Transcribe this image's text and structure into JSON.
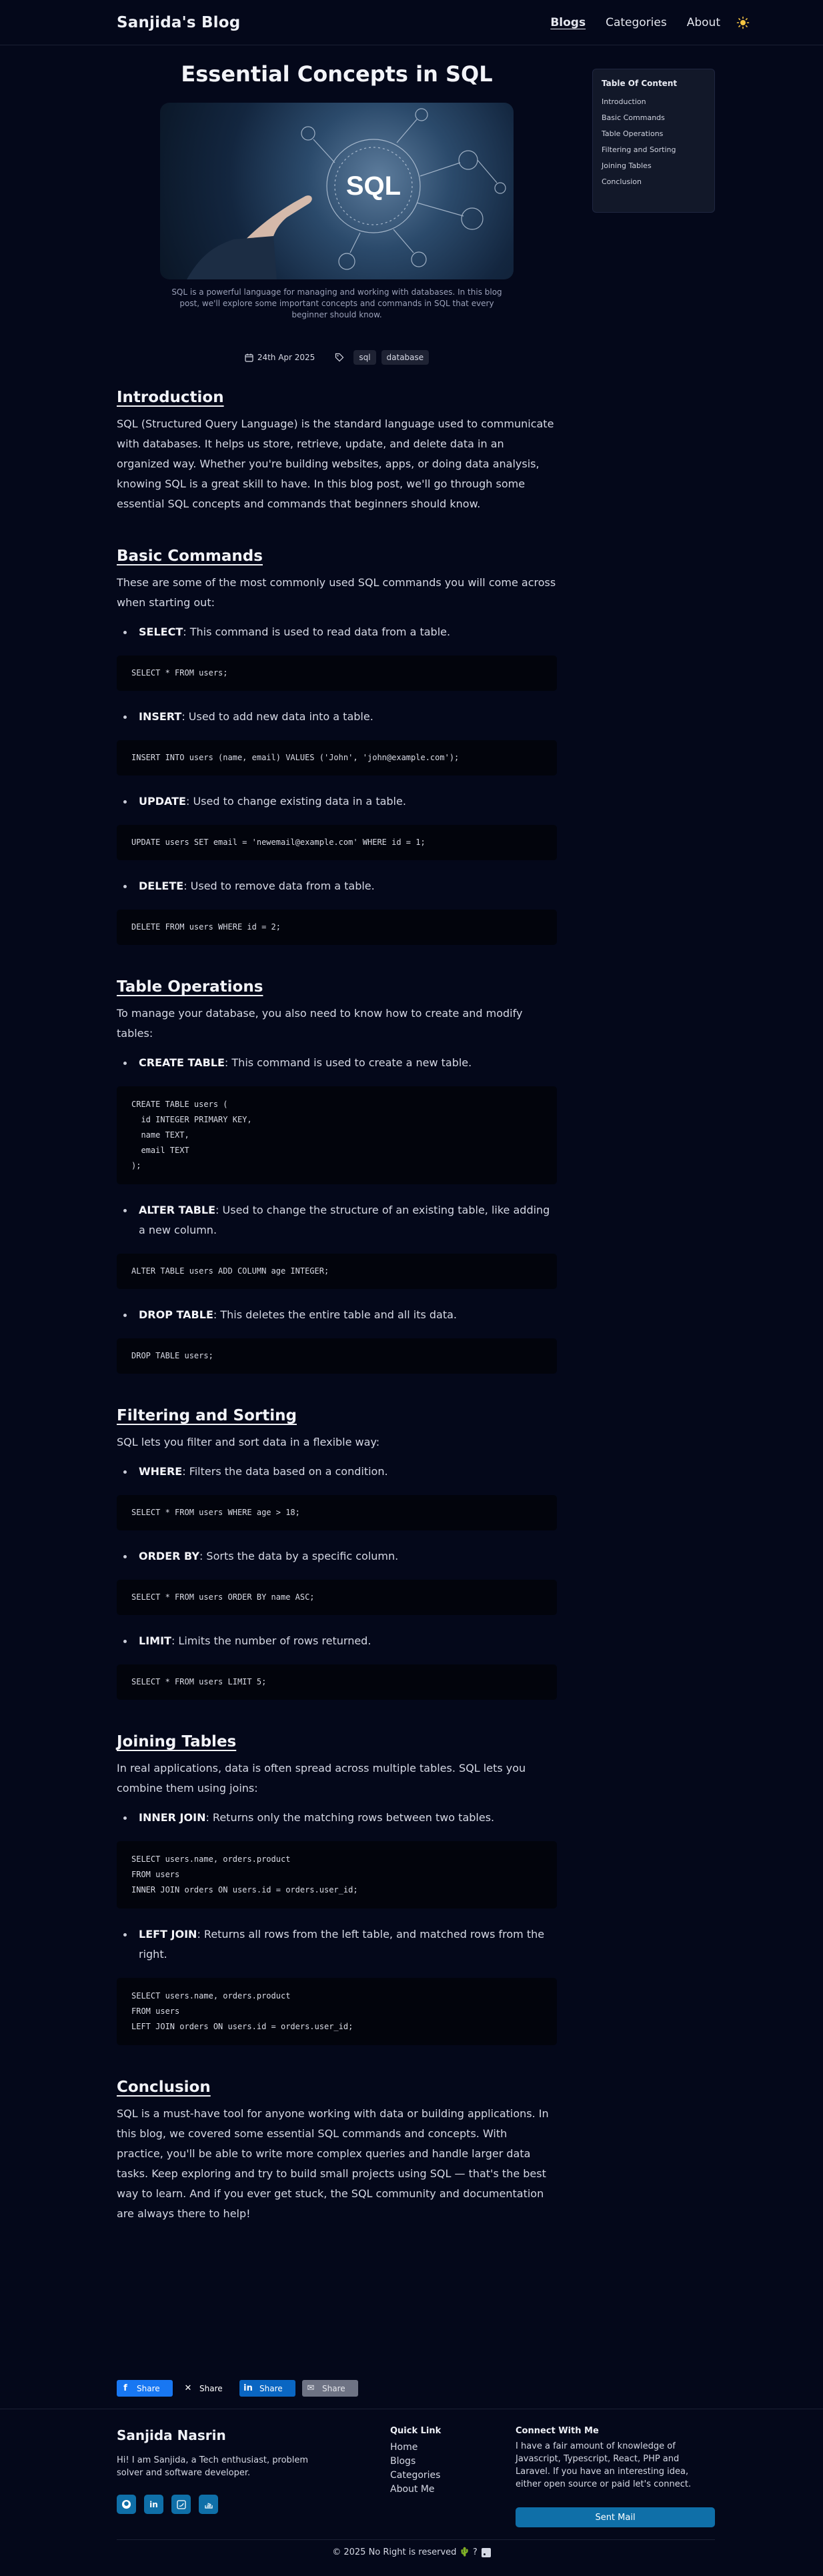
{
  "header": {
    "brand": "Sanjida's Blog",
    "nav": [
      "Blogs",
      "Categories",
      "About"
    ],
    "theme_icon": "sun-icon"
  },
  "article": {
    "title": "Essential Concepts in SQL",
    "hero_text": "SQL",
    "caption": "SQL is a powerful language for managing and working with databases. In this blog post, we'll explore some important concepts and commands in SQL that every beginner should know.",
    "date": "24th Apr 2025",
    "tags": [
      "sql",
      "database"
    ],
    "sections": [
      {
        "heading": "Introduction",
        "intro": "SQL (Structured Query Language) is the standard language used to communicate with databases. It helps us store, retrieve, update, and delete data in an organized way. Whether you're building websites, apps, or doing data analysis, knowing SQL is a great skill to have. In this blog post, we'll go through some essential SQL concepts and commands that beginners should know.",
        "items": []
      },
      {
        "heading": "Basic Commands",
        "intro": "These are some of the most commonly used SQL commands you will come across when starting out:",
        "items": [
          {
            "term": "SELECT",
            "desc": ": This command is used to read data from a table.",
            "code": "SELECT * FROM users;"
          },
          {
            "term": "INSERT",
            "desc": ": Used to add new data into a table.",
            "code": "INSERT INTO users (name, email) VALUES ('John', 'john@example.com');"
          },
          {
            "term": "UPDATE",
            "desc": ": Used to change existing data in a table.",
            "code": "UPDATE users SET email = 'newemail@example.com' WHERE id = 1;"
          },
          {
            "term": "DELETE",
            "desc": ": Used to remove data from a table.",
            "code": "DELETE FROM users WHERE id = 2;"
          }
        ]
      },
      {
        "heading": "Table Operations",
        "intro": "To manage your database, you also need to know how to create and modify tables:",
        "items": [
          {
            "term": "CREATE TABLE",
            "desc": ": This command is used to create a new table.",
            "code": "CREATE TABLE users (\n  id INTEGER PRIMARY KEY,\n  name TEXT,\n  email TEXT\n);"
          },
          {
            "term": "ALTER TABLE",
            "desc": ": Used to change the structure of an existing table, like adding a new column.",
            "code": "ALTER TABLE users ADD COLUMN age INTEGER;"
          },
          {
            "term": "DROP TABLE",
            "desc": ": This deletes the entire table and all its data.",
            "code": "DROP TABLE users;"
          }
        ]
      },
      {
        "heading": "Filtering and Sorting",
        "intro": "SQL lets you filter and sort data in a flexible way:",
        "items": [
          {
            "term": "WHERE",
            "desc": ": Filters the data based on a condition.",
            "code": "SELECT * FROM users WHERE age > 18;"
          },
          {
            "term": "ORDER BY",
            "desc": ": Sorts the data by a specific column.",
            "code": "SELECT * FROM users ORDER BY name ASC;"
          },
          {
            "term": "LIMIT",
            "desc": ": Limits the number of rows returned.",
            "code": "SELECT * FROM users LIMIT 5;"
          }
        ]
      },
      {
        "heading": "Joining Tables",
        "intro": "In real applications, data is often spread across multiple tables. SQL lets you combine them using joins:",
        "items": [
          {
            "term": "INNER JOIN",
            "desc": ": Returns only the matching rows between two tables.",
            "code": "SELECT users.name, orders.product\nFROM users\nINNER JOIN orders ON users.id = orders.user_id;"
          },
          {
            "term": "LEFT JOIN",
            "desc": ": Returns all rows from the left table, and matched rows from the right.",
            "code": "SELECT users.name, orders.product\nFROM users\nLEFT JOIN orders ON users.id = orders.user_id;"
          }
        ]
      },
      {
        "heading": "Conclusion",
        "intro": "SQL is a must-have tool for anyone working with data or building applications. In this blog, we covered some essential SQL commands and concepts. With practice, you'll be able to write more complex queries and handle larger data tasks. Keep exploring and try to build small projects using SQL — that's the best way to learn. And if you ever get stuck, the SQL community and documentation are always there to help!",
        "items": []
      }
    ]
  },
  "toc": {
    "title": "Table Of Content",
    "items": [
      "Introduction",
      "Basic Commands",
      "Table Operations",
      "Filtering and Sorting",
      "Joining Tables",
      "Conclusion"
    ]
  },
  "share": {
    "facebook": "Share",
    "x": "Share",
    "linkedin": "Share",
    "email": "Share"
  },
  "footer": {
    "name": "Sanjida Nasrin",
    "bio": "Hi! I am Sanjida, a Tech enthusiast, problem solver and software developer.",
    "quick_link_title": "Quick Link",
    "quick_links": [
      "Home",
      "Blogs",
      "Categories",
      "About Me"
    ],
    "connect_title": "Connect With Me",
    "connect_text": "I have a fair amount of knowledge of Javascript, Typescript, React, PHP and Laravel. If you have an interesting idea, either open source or paid let's connect.",
    "mail_button": "Sent Mail",
    "copyright": "© 2025 No Right is reserved 🌵 ?",
    "socials": [
      "github-icon",
      "linkedin-icon",
      "twitter-icon",
      "stackoverflow-icon"
    ]
  },
  "colors": {
    "background": "#04081a",
    "code_background": "#02040c",
    "accent": "#0f6fa8"
  }
}
